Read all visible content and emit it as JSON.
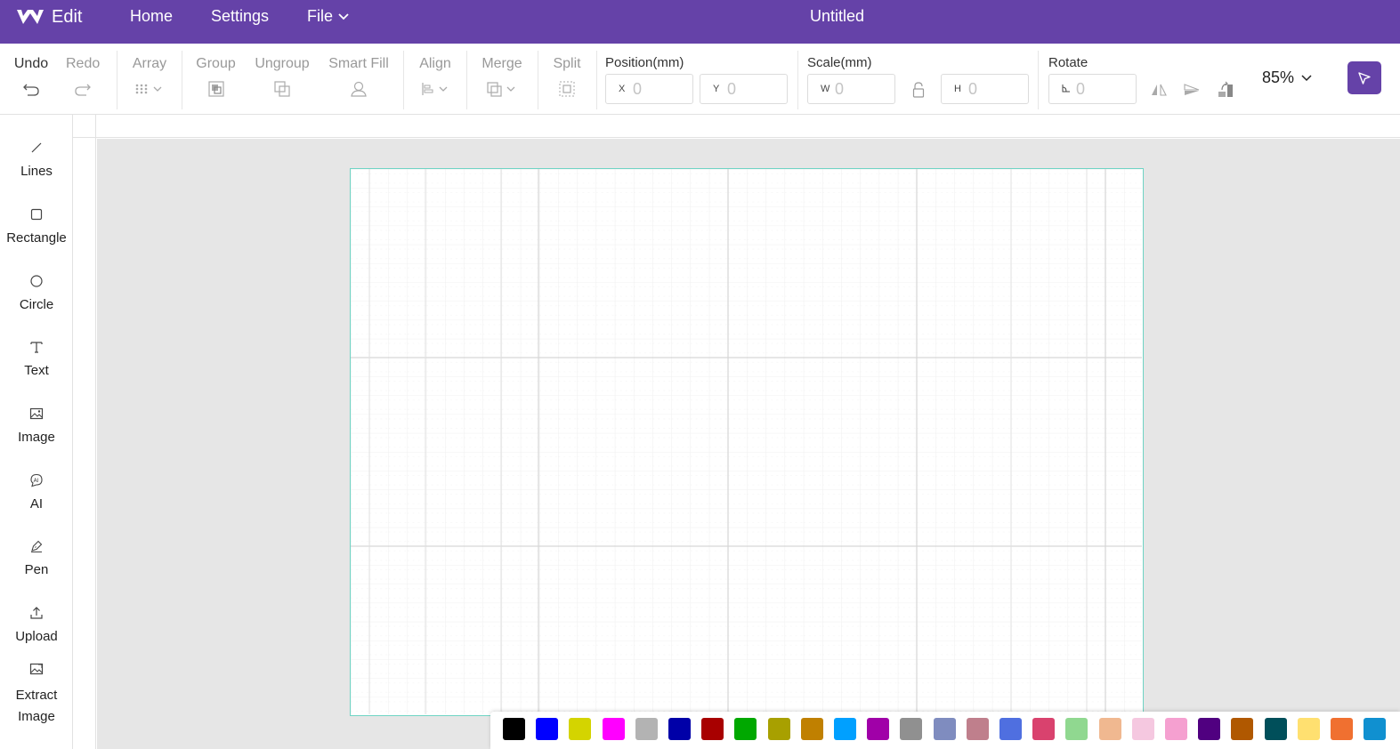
{
  "topbar": {
    "app_name": "Edit",
    "nav": {
      "home": "Home",
      "settings": "Settings",
      "file": "File"
    },
    "title": "Untitled"
  },
  "toolbar": {
    "undo": "Undo",
    "redo": "Redo",
    "array": "Array",
    "group": "Group",
    "ungroup": "Ungroup",
    "smart_fill": "Smart Fill",
    "align": "Align",
    "merge": "Merge",
    "split": "Split",
    "position_label": "Position(mm)",
    "x_prefix": "X",
    "y_prefix": "Y",
    "x_value": "0",
    "y_value": "0",
    "scale_label": "Scale(mm)",
    "w_prefix": "W",
    "h_prefix": "H",
    "w_value": "0",
    "h_value": "0",
    "rotate_label": "Rotate",
    "rotate_value": "0",
    "zoom": "85%"
  },
  "sidebar": {
    "items": [
      {
        "label": "Lines",
        "icon": "line-icon"
      },
      {
        "label": "Rectangle",
        "icon": "rectangle-icon"
      },
      {
        "label": "Circle",
        "icon": "circle-icon"
      },
      {
        "label": "Text",
        "icon": "text-icon"
      },
      {
        "label": "Image",
        "icon": "image-icon"
      },
      {
        "label": "AI",
        "icon": "ai-icon"
      },
      {
        "label": "Pen",
        "icon": "pen-icon"
      },
      {
        "label": "Upload",
        "icon": "upload-icon"
      },
      {
        "label": "Extract Image",
        "icon": "extract-image-icon"
      }
    ]
  },
  "colors": {
    "brand": "#6542a8",
    "page_border": "#6fd4c4",
    "workspace": "#e6e6e6"
  },
  "palette": [
    "#000000",
    "#0000ff",
    "#d4d400",
    "#ff00ff",
    "#b3b3b3",
    "#0000a8",
    "#a80000",
    "#00a800",
    "#a8a000",
    "#c08000",
    "#00a0ff",
    "#a000a8",
    "#909090",
    "#7f8cbf",
    "#bf7f8c",
    "#4f6fe0",
    "#d9426e",
    "#90d890",
    "#f0b890",
    "#f5c8e0",
    "#f5a0d0",
    "#500080",
    "#b05800",
    "#004f5a",
    "#ffe070",
    "#f07030",
    "#1090d0"
  ]
}
